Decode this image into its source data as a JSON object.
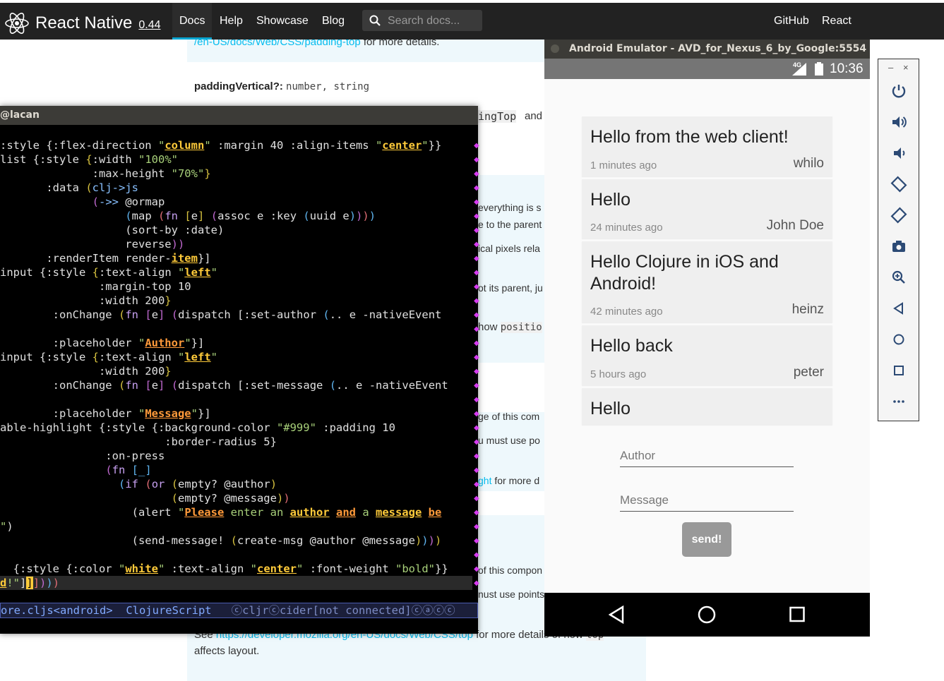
{
  "docs_nav": {
    "brand": "React Native",
    "version": "0.44",
    "items": [
      "Docs",
      "Help",
      "Showcase",
      "Blog"
    ],
    "search_placeholder": "Search docs...",
    "right_items": [
      "GitHub",
      "React"
    ]
  },
  "docs": {
    "top_link": "/en-US/docs/Web/CSS/padding-top",
    "top_text": " for more details.",
    "prop_name": "paddingVertical?:",
    "prop_type": "number, string",
    "frag_ingtop": "ingTop",
    "frag_and": "and",
    "frag_everything": "everything is s",
    "frag_parent": "e to the parent",
    "frag_pixels": "ical pixels rela",
    "frag_parentju": "ot its parent, ju",
    "frag_howpos": "how",
    "frag_position": "positio",
    "frag_ge": "ge of this com",
    "frag_mustuse": "u must use po",
    "frag_ght": "ght",
    "frag_formore": " for more d",
    "frag_comp": "of this compon",
    "frag_points": "nust use points",
    "bottom_see": "See ",
    "bottom_link": "https://developer.mozilla.org/en-US/docs/Web/CSS/top",
    "bottom_text": " for more details of how ",
    "bottom_code": "top",
    "bottom_line2": "affects layout."
  },
  "emacs": {
    "title": "@lacan",
    "code_lines": [
      [
        [
          "",
          ":style {:flex-direction "
        ],
        [
          "str",
          "\""
        ],
        [
          "strh",
          "column"
        ],
        [
          "str",
          "\""
        ],
        [
          "",
          " :margin 40 :align-items "
        ],
        [
          "str",
          "\""
        ],
        [
          "strh",
          "center"
        ],
        [
          "str",
          "\""
        ],
        [
          "",
          "}}"
        ]
      ],
      [
        [
          "",
          "list {:style "
        ],
        [
          "p1",
          "{"
        ],
        [
          "",
          ":width "
        ],
        [
          "str",
          "\"100%\""
        ]
      ],
      [
        [
          "",
          "              :max-height "
        ],
        [
          "str",
          "\"70%\""
        ],
        [
          "p1",
          "}"
        ]
      ],
      [
        [
          "",
          "       :data "
        ],
        [
          "p1",
          "("
        ],
        [
          "fn",
          "clj->js"
        ]
      ],
      [
        [
          "",
          "              "
        ],
        [
          "p2",
          "("
        ],
        [
          "fn",
          "->>"
        ],
        [
          "",
          " @ormap"
        ]
      ],
      [
        [
          "",
          "                   "
        ],
        [
          "p3",
          "("
        ],
        [
          "",
          "map "
        ],
        [
          "p4",
          "("
        ],
        [
          "kw",
          "fn"
        ],
        [
          "",
          " "
        ],
        [
          "p1",
          "["
        ],
        [
          "",
          "e"
        ],
        [
          "p1",
          "]"
        ],
        [
          "",
          " "
        ],
        [
          "p2",
          "("
        ],
        [
          "",
          "assoc e :key "
        ],
        [
          "p3",
          "("
        ],
        [
          "",
          "uuid e"
        ],
        [
          "p3",
          ")"
        ],
        [
          "p2",
          ")"
        ],
        [
          "p4",
          ")"
        ],
        [
          "p3",
          ")"
        ]
      ],
      [
        [
          "",
          "                   (sort-by :date)"
        ]
      ],
      [
        [
          "",
          "                   reverse"
        ],
        [
          "p2",
          "))"
        ]
      ],
      [
        [
          "",
          "       :renderItem render-"
        ],
        [
          "strh",
          "item"
        ],
        [
          "",
          "}]"
        ]
      ],
      [
        [
          "",
          "input {:style "
        ],
        [
          "p1",
          "{"
        ],
        [
          "",
          ":text-align "
        ],
        [
          "str",
          "\""
        ],
        [
          "strh",
          "left"
        ],
        [
          "str",
          "\""
        ]
      ],
      [
        [
          "",
          "               :margin-top 10"
        ]
      ],
      [
        [
          "",
          "               :width 200"
        ],
        [
          "p1",
          "}"
        ]
      ],
      [
        [
          "",
          "        :onChange "
        ],
        [
          "p1",
          "("
        ],
        [
          "kw",
          "fn"
        ],
        [
          "",
          " "
        ],
        [
          "p2",
          "["
        ],
        [
          "",
          "e"
        ],
        [
          "p2",
          "]"
        ],
        [
          "",
          " "
        ],
        [
          "p2",
          "("
        ],
        [
          "",
          "dispatch [:set-author "
        ],
        [
          "p3",
          "("
        ],
        [
          "",
          ".. e -nativeEvent"
        ]
      ],
      [
        [
          "",
          ""
        ]
      ],
      [
        [
          "",
          "        :placeholder "
        ],
        [
          "str",
          "\""
        ],
        [
          "strh2",
          "Author"
        ],
        [
          "str",
          "\""
        ],
        [
          "",
          "}]"
        ]
      ],
      [
        [
          "",
          "input {:style "
        ],
        [
          "p1",
          "{"
        ],
        [
          "",
          ":text-align "
        ],
        [
          "str",
          "\""
        ],
        [
          "strh",
          "left"
        ],
        [
          "str",
          "\""
        ]
      ],
      [
        [
          "",
          "               :width 200"
        ],
        [
          "p1",
          "}"
        ]
      ],
      [
        [
          "",
          "        :onChange "
        ],
        [
          "p1",
          "("
        ],
        [
          "kw",
          "fn"
        ],
        [
          "",
          " "
        ],
        [
          "p2",
          "["
        ],
        [
          "",
          "e"
        ],
        [
          "p2",
          "]"
        ],
        [
          "",
          " "
        ],
        [
          "p2",
          "("
        ],
        [
          "",
          "dispatch [:set-message "
        ],
        [
          "p3",
          "("
        ],
        [
          "",
          ".. e -nativeEvent"
        ]
      ],
      [
        [
          "",
          ""
        ]
      ],
      [
        [
          "",
          "        :placeholder "
        ],
        [
          "str",
          "\""
        ],
        [
          "strh2",
          "Message"
        ],
        [
          "str",
          "\""
        ],
        [
          "",
          "}]"
        ]
      ],
      [
        [
          "",
          "able-highlight {:style {:background-color "
        ],
        [
          "str",
          "\"#999\""
        ],
        [
          "",
          " :padding 10"
        ]
      ],
      [
        [
          "",
          "                         :border-radius 5}"
        ]
      ],
      [
        [
          "",
          "                :on-press"
        ]
      ],
      [
        [
          "",
          "                "
        ],
        [
          "p2",
          "("
        ],
        [
          "kw",
          "fn"
        ],
        [
          "",
          " "
        ],
        [
          "p3",
          "[_]"
        ]
      ],
      [
        [
          "",
          "                  "
        ],
        [
          "p3",
          "("
        ],
        [
          "kw",
          "if"
        ],
        [
          "",
          " "
        ],
        [
          "p4",
          "("
        ],
        [
          "kw",
          "or"
        ],
        [
          "",
          " "
        ],
        [
          "p1",
          "("
        ],
        [
          "",
          "empty? @author"
        ],
        [
          "p1",
          ")"
        ]
      ],
      [
        [
          "",
          "                          "
        ],
        [
          "p1",
          "("
        ],
        [
          "",
          "empty? @message"
        ],
        [
          "p1",
          ")"
        ],
        [
          "p4",
          ")"
        ]
      ],
      [
        [
          "",
          "                    (alert "
        ],
        [
          "str",
          "\""
        ],
        [
          "strh2",
          "Please"
        ],
        [
          "str",
          " enter an "
        ],
        [
          "strh",
          "author"
        ],
        [
          "str",
          " "
        ],
        [
          "strh2",
          "and"
        ],
        [
          "str",
          " a "
        ],
        [
          "strh",
          "message"
        ],
        [
          "str",
          " "
        ],
        [
          "strh2",
          "be"
        ]
      ],
      [
        [
          "str",
          "\""
        ],
        [
          "",
          ")"
        ]
      ],
      [
        [
          "",
          "                    (send-message! "
        ],
        [
          "p1",
          "("
        ],
        [
          "",
          "create-msg @author @message"
        ],
        [
          "p1",
          ")"
        ],
        [
          "p3",
          ")"
        ],
        [
          "p2",
          ")"
        ],
        [
          "p1",
          ")"
        ]
      ],
      [
        [
          "",
          ""
        ]
      ],
      [
        [
          "",
          ""
        ],
        [
          "",
          "  {:style {:color "
        ],
        [
          "str",
          "\""
        ],
        [
          "strh",
          "white"
        ],
        [
          "str",
          "\""
        ],
        [
          "",
          " :text-align "
        ],
        [
          "str",
          "\""
        ],
        [
          "strh",
          "center"
        ],
        [
          "str",
          "\""
        ],
        [
          "",
          " :font-weight "
        ],
        [
          "str",
          "\"bold\""
        ],
        [
          "",
          "}}"
        ]
      ]
    ],
    "mini_line": [
      [
        "strh",
        "d"
      ],
      [
        "str",
        "!\""
      ],
      [
        "",
        "]"
      ],
      [
        "cur",
        "]"
      ],
      [
        "p4",
        "]"
      ],
      [
        "p2",
        ")"
      ],
      [
        "p3",
        ")"
      ],
      [
        "p4",
        ")"
      ]
    ],
    "modeline_file": "ore.cljs<android>",
    "modeline_mode": "ClojureScript",
    "modeline_rest": "ⓒcljrⓒcider[not connected]ⓒⓐⓒⓒ"
  },
  "emulator": {
    "title": "Android Emulator - AVD_for_Nexus_6_by_Google:5554",
    "clock": "10:36",
    "network": "4G",
    "messages": [
      {
        "text": "Hello from the web client!",
        "time": "1 minutes ago",
        "author": "whilo"
      },
      {
        "text": "Hello",
        "time": "24 minutes ago",
        "author": "John Doe"
      },
      {
        "text": "Hello Clojure in iOS and Android!",
        "time": "42 minutes ago",
        "author": "heinz"
      },
      {
        "text": "Hello back",
        "time": "5 hours ago",
        "author": "peter"
      },
      {
        "text": "Hello",
        "time": "",
        "author": ""
      }
    ],
    "author_placeholder": "Author",
    "message_placeholder": "Message",
    "send_label": "send!",
    "side_minimize": "–",
    "side_close": "×"
  }
}
